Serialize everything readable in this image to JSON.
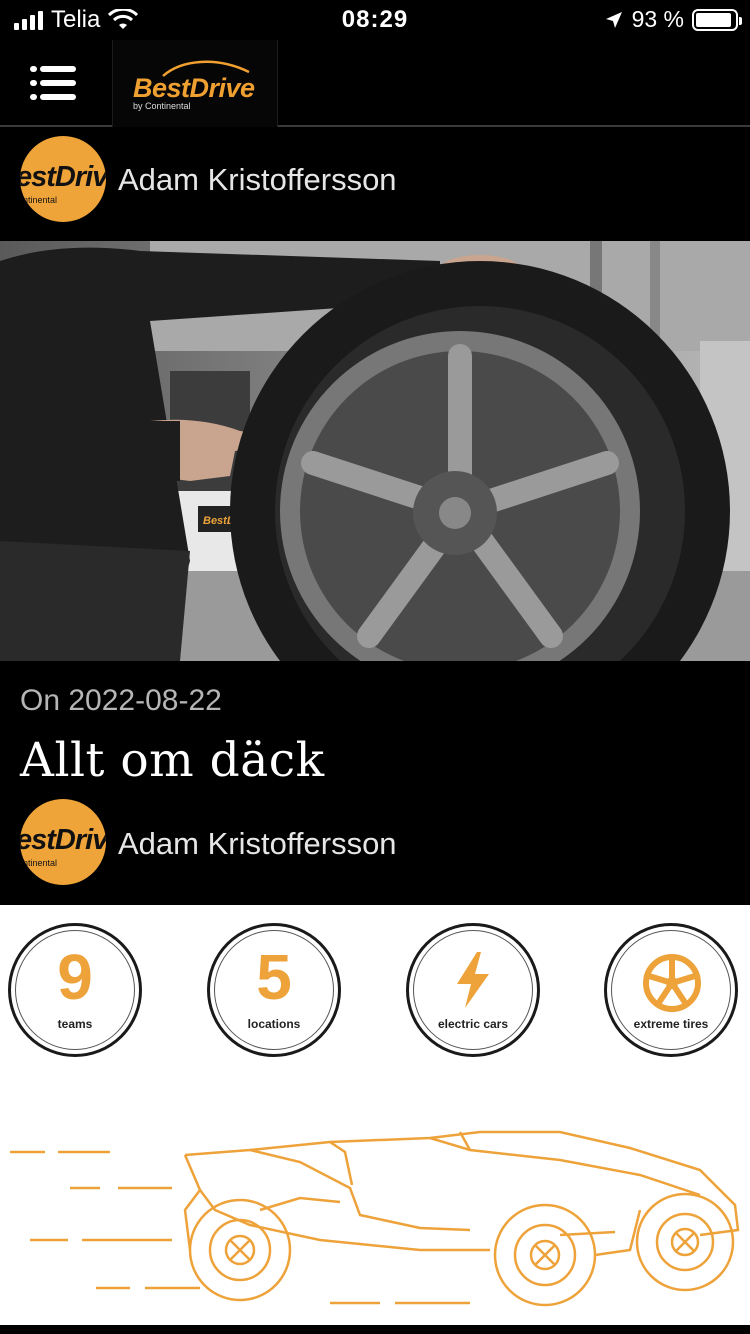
{
  "status_bar": {
    "carrier": "Telia",
    "time": "08:29",
    "battery": "93 %",
    "battery_level": 0.93
  },
  "header": {
    "menu_icon": "hamburger-menu-icon",
    "logo_text": "BestDrive",
    "logo_sub": "by Continental"
  },
  "author_top": {
    "avatar_text": "estDriv",
    "avatar_sub": "ntinental",
    "name": "Adam Kristoffersson"
  },
  "article": {
    "date": "On 2022-08-22",
    "title": "Allt om däck",
    "hero_image": "mechanic-pointing-at-tire-photo"
  },
  "author_bottom": {
    "avatar_text": "estDriv",
    "avatar_sub": "ntinental",
    "name": "Adam Kristoffersson"
  },
  "stats": [
    {
      "value": "9",
      "label": "teams"
    },
    {
      "value": "5",
      "label": "locations"
    },
    {
      "value": "",
      "label": "electric cars",
      "icon": "lightning-icon"
    },
    {
      "value": "",
      "label": "extreme tires",
      "icon": "wheel-icon"
    }
  ],
  "colors": {
    "brand_orange": "#efa43a",
    "background": "#000000"
  }
}
